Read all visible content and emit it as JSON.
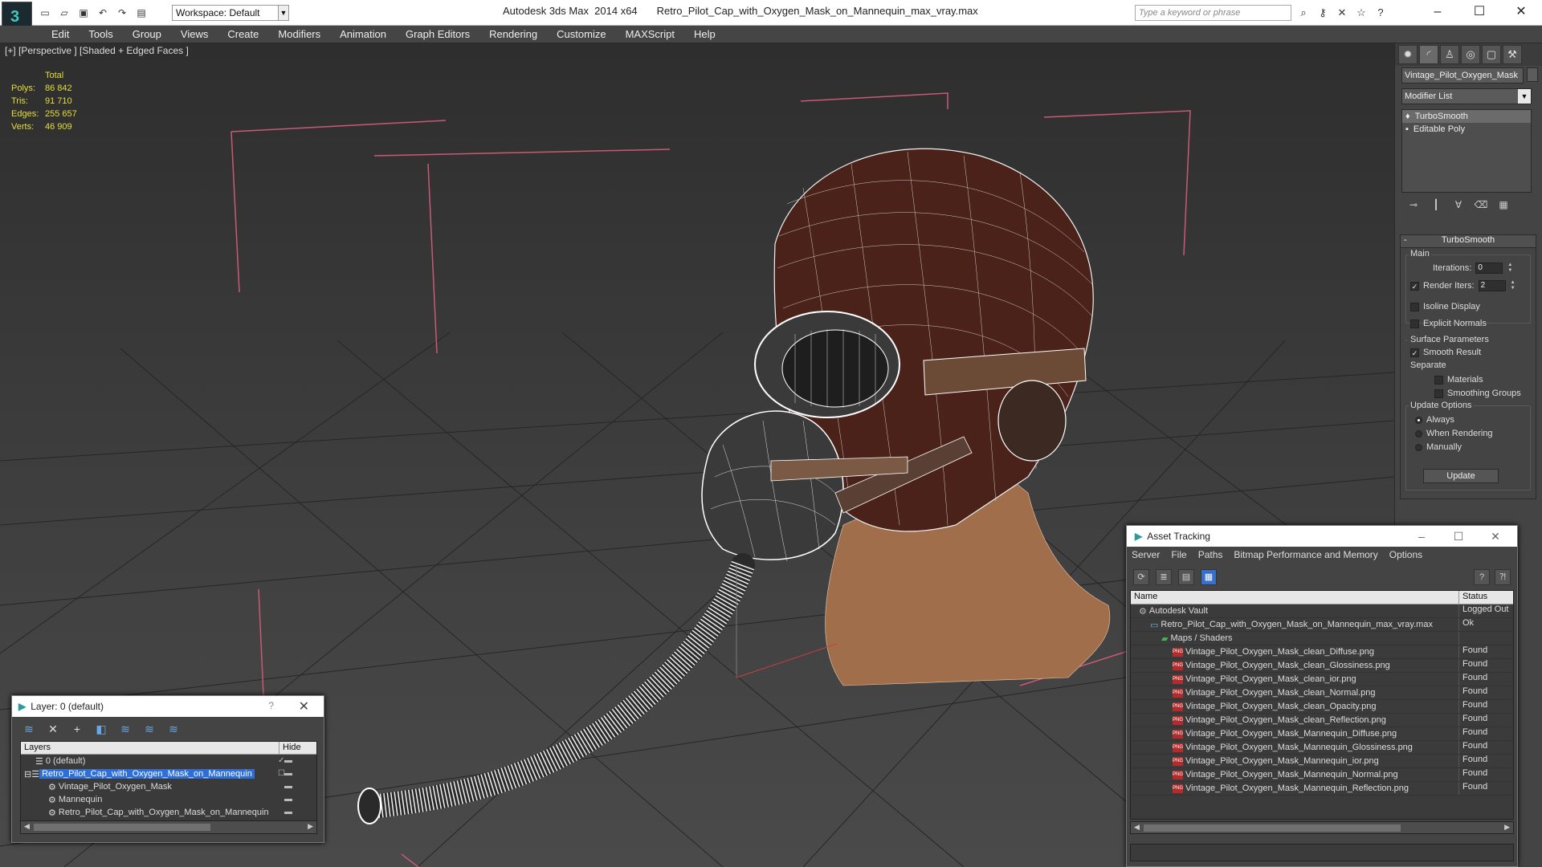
{
  "titlebar": {
    "app_title": "Autodesk 3ds Max  2014 x64",
    "file_title": "Retro_Pilot_Cap_with_Oxygen_Mask_on_Mannequin_max_vray.max",
    "workspace": "Workspace: Default",
    "search_placeholder": "Type a keyword or phrase"
  },
  "menu": [
    "Edit",
    "Tools",
    "Group",
    "Views",
    "Create",
    "Modifiers",
    "Animation",
    "Graph Editors",
    "Rendering",
    "Customize",
    "MAXScript",
    "Help"
  ],
  "viewport": {
    "label": "[+] [Perspective ] [Shaded + Edged Faces ]",
    "stats": {
      "header": "Total",
      "rows": [
        {
          "k": "Polys:",
          "v": "86 842"
        },
        {
          "k": "Tris:",
          "v": "91 710"
        },
        {
          "k": "Edges:",
          "v": "255 657"
        },
        {
          "k": "Verts:",
          "v": "46 909"
        }
      ]
    }
  },
  "command_panel": {
    "object_name": "Vintage_Pilot_Oxygen_Mask",
    "modifier_list": "Modifier List",
    "stack": [
      "TurboSmooth",
      "Editable Poly"
    ],
    "rollout": {
      "title": "TurboSmooth",
      "main_label": "Main",
      "iterations_label": "Iterations:",
      "iterations_value": "0",
      "render_iters_label": "Render Iters:",
      "render_iters_value": "2",
      "isoline": "Isoline Display",
      "explicit": "Explicit Normals",
      "surface_label": "Surface Parameters",
      "smooth_result": "Smooth Result",
      "separate_label": "Separate",
      "materials": "Materials",
      "smoothing_groups": "Smoothing Groups",
      "update_label": "Update Options",
      "always": "Always",
      "when_rendering": "When Rendering",
      "manually": "Manually",
      "update_button": "Update"
    }
  },
  "layer_window": {
    "title": "Layer: 0 (default)",
    "help": "?",
    "col_layers": "Layers",
    "col_hide": "Hide",
    "rows": [
      {
        "name": "0 (default)",
        "indent": 1
      },
      {
        "name": "Retro_Pilot_Cap_with_Oxygen_Mask_on_Mannequin",
        "indent": 1
      },
      {
        "name": "Vintage_Pilot_Oxygen_Mask",
        "indent": 2
      },
      {
        "name": "Mannequin",
        "indent": 2
      },
      {
        "name": "Retro_Pilot_Cap_with_Oxygen_Mask_on_Mannequin",
        "indent": 2
      }
    ]
  },
  "asset_window": {
    "title": "Asset Tracking",
    "menu": [
      "Server",
      "File",
      "Paths",
      "Bitmap Performance and Memory",
      "Options"
    ],
    "col_name": "Name",
    "col_status": "Status",
    "rows": [
      {
        "name": "Autodesk Vault",
        "status": "Logged Out",
        "indent": 1,
        "icon": "vault"
      },
      {
        "name": "Retro_Pilot_Cap_with_Oxygen_Mask_on_Mannequin_max_vray.max",
        "status": "Ok",
        "indent": 2,
        "icon": "max"
      },
      {
        "name": "Maps / Shaders",
        "status": "",
        "indent": 3,
        "icon": "maps"
      },
      {
        "name": "Vintage_Pilot_Oxygen_Mask_clean_Diffuse.png",
        "status": "Found",
        "indent": 4,
        "icon": "png"
      },
      {
        "name": "Vintage_Pilot_Oxygen_Mask_clean_Glossiness.png",
        "status": "Found",
        "indent": 4,
        "icon": "png"
      },
      {
        "name": "Vintage_Pilot_Oxygen_Mask_clean_ior.png",
        "status": "Found",
        "indent": 4,
        "icon": "png"
      },
      {
        "name": "Vintage_Pilot_Oxygen_Mask_clean_Normal.png",
        "status": "Found",
        "indent": 4,
        "icon": "png"
      },
      {
        "name": "Vintage_Pilot_Oxygen_Mask_clean_Opacity.png",
        "status": "Found",
        "indent": 4,
        "icon": "png"
      },
      {
        "name": "Vintage_Pilot_Oxygen_Mask_clean_Reflection.png",
        "status": "Found",
        "indent": 4,
        "icon": "png"
      },
      {
        "name": "Vintage_Pilot_Oxygen_Mask_Mannequin_Diffuse.png",
        "status": "Found",
        "indent": 4,
        "icon": "png"
      },
      {
        "name": "Vintage_Pilot_Oxygen_Mask_Mannequin_Glossiness.png",
        "status": "Found",
        "indent": 4,
        "icon": "png"
      },
      {
        "name": "Vintage_Pilot_Oxygen_Mask_Mannequin_ior.png",
        "status": "Found",
        "indent": 4,
        "icon": "png"
      },
      {
        "name": "Vintage_Pilot_Oxygen_Mask_Mannequin_Normal.png",
        "status": "Found",
        "indent": 4,
        "icon": "png"
      },
      {
        "name": "Vintage_Pilot_Oxygen_Mask_Mannequin_Reflection.png",
        "status": "Found",
        "indent": 4,
        "icon": "png"
      }
    ]
  },
  "colors": {
    "stats_yellow": "#e6df3a",
    "selection_blue": "#2d6fd6",
    "gizmo_pink": "#d0607a",
    "skin": "#b07a55",
    "cap": "#5a2a1e"
  }
}
